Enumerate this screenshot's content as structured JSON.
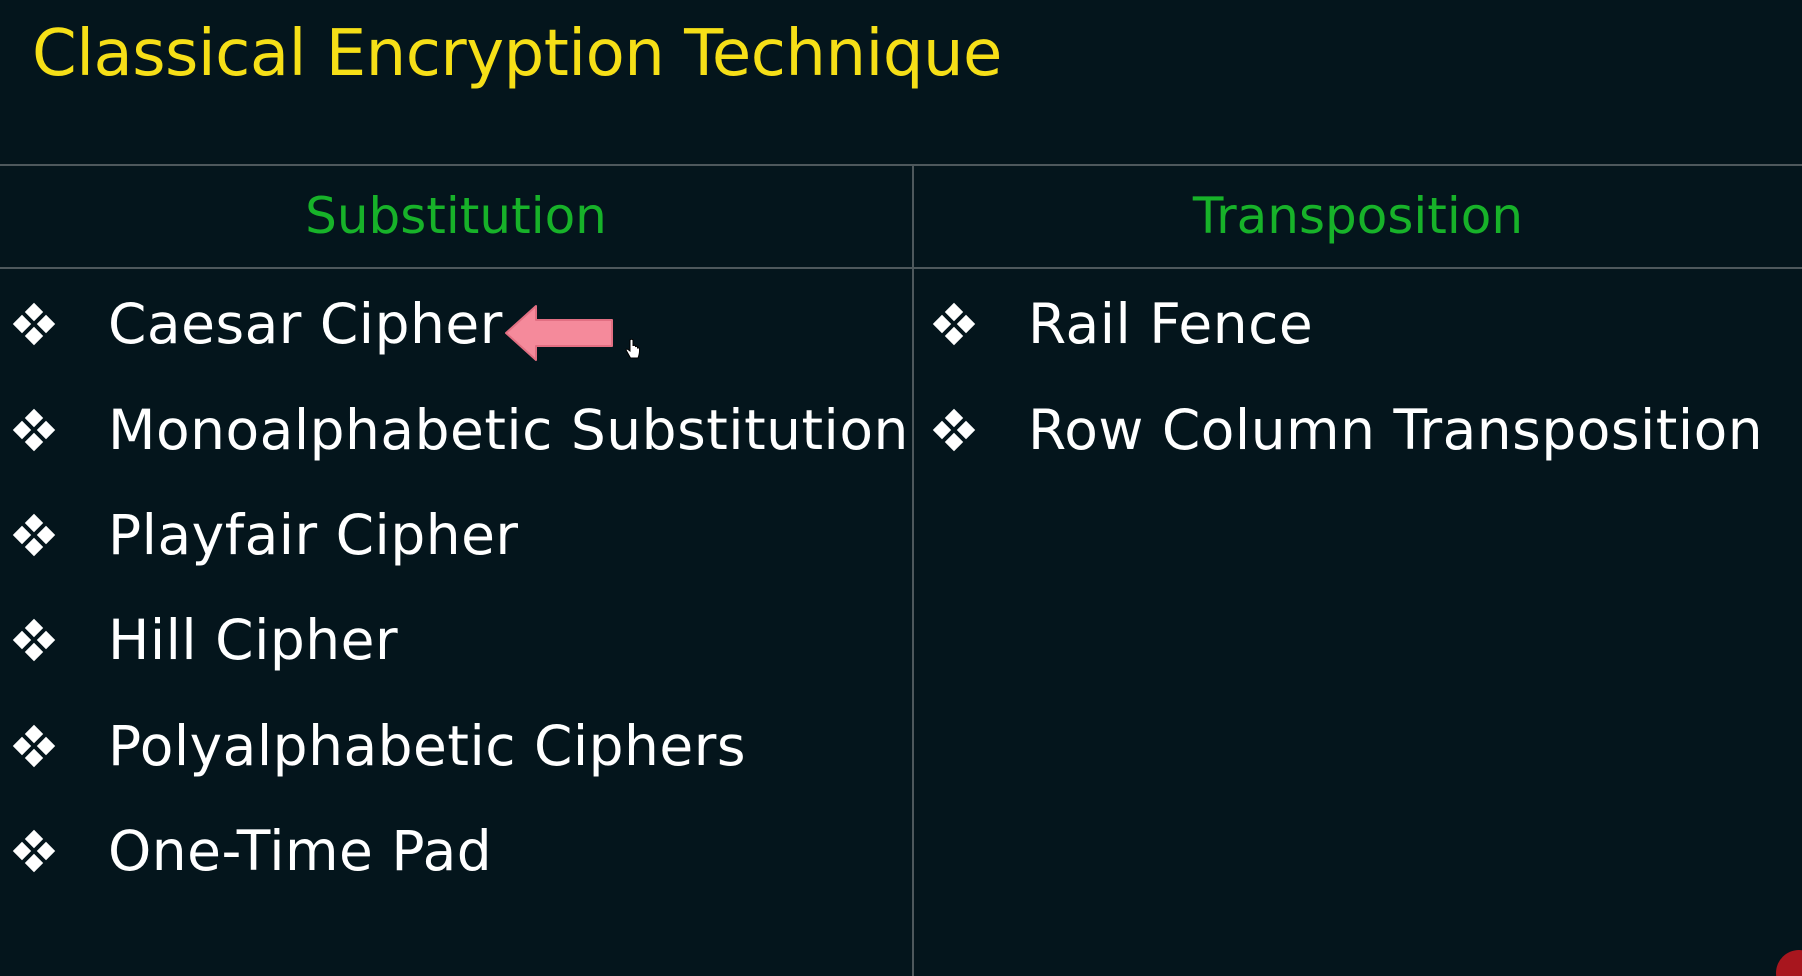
{
  "title": "Classical Encryption Technique",
  "colors": {
    "background": "#04151c",
    "title": "#f6df17",
    "heading": "#17b229",
    "item_text": "#ffffff",
    "divider": "#4e585c",
    "arrow": "#f58a9b"
  },
  "bullet_icon": "diamond-four-bullet-icon",
  "columns": {
    "left": {
      "heading": "Substitution",
      "items": [
        "Caesar Cipher",
        "Monoalphabetic Substitution",
        "Playfair Cipher",
        "Hill Cipher",
        "Polyalphabetic Ciphers",
        "One-Time Pad"
      ]
    },
    "right": {
      "heading": "Transposition",
      "items": [
        "Rail Fence",
        "Row Column Transposition"
      ]
    }
  },
  "annotation": {
    "icon": "left-arrow-icon",
    "points_to": "Caesar Cipher"
  }
}
